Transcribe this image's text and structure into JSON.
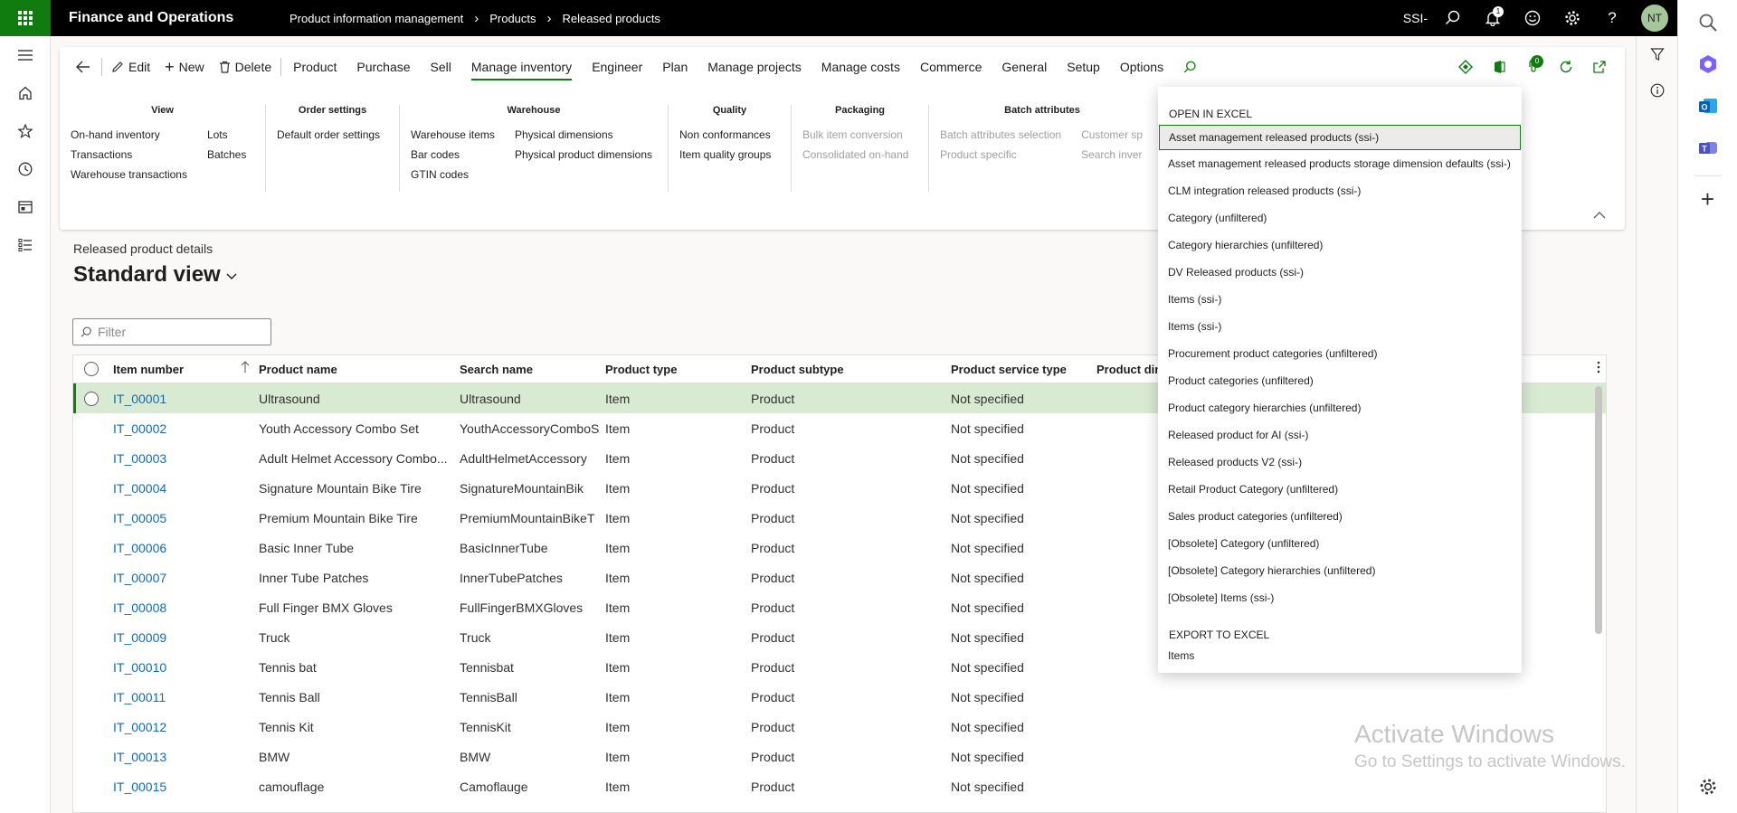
{
  "header": {
    "app_title": "Finance and Operations",
    "breadcrumbs": [
      "Product information management",
      "Products",
      "Released products"
    ],
    "company": "SSI-",
    "notification_count": "1",
    "user_initials": "NT"
  },
  "actionpane": {
    "back_icon": "back-arrow-icon",
    "buttons": [
      {
        "label": "Edit",
        "icon": "pencil-icon"
      },
      {
        "label": "New",
        "icon": "plus-icon"
      },
      {
        "label": "Delete",
        "icon": "trash-icon"
      }
    ],
    "tabs": [
      "Product",
      "Purchase",
      "Sell",
      "Manage inventory",
      "Engineer",
      "Plan",
      "Manage projects",
      "Manage costs",
      "Commerce",
      "General",
      "Setup",
      "Options"
    ],
    "active_tab": "Manage inventory",
    "office_badge": "0",
    "groups": [
      {
        "title": "View",
        "columns": [
          [
            "On-hand inventory",
            "Transactions",
            "Warehouse transactions"
          ],
          [
            "Lots",
            "Batches"
          ]
        ]
      },
      {
        "title": "Order settings",
        "columns": [
          [
            "Default order settings"
          ]
        ]
      },
      {
        "title": "Warehouse",
        "columns": [
          [
            "Warehouse items",
            "Bar codes",
            "GTIN codes"
          ],
          [
            "Physical dimensions",
            "Physical product dimensions"
          ]
        ]
      },
      {
        "title": "Quality",
        "columns": [
          [
            "Non conformances",
            "Item quality groups"
          ]
        ]
      },
      {
        "title": "Packaging",
        "columns": [
          [
            "Bulk item conversion",
            "Consolidated on-hand"
          ]
        ]
      },
      {
        "title": "Batch attributes",
        "columns": [
          [
            "Batch attributes selection",
            "Product specific"
          ],
          [
            "Customer sp",
            "Search inver"
          ]
        ]
      }
    ]
  },
  "page": {
    "subtitle": "Released product details",
    "view_name": "Standard view",
    "filter_placeholder": "Filter"
  },
  "grid": {
    "columns": [
      "Item number",
      "Product name",
      "Search name",
      "Product type",
      "Product subtype",
      "Product service type",
      "Product dime"
    ],
    "rows": [
      {
        "item": "IT_00001",
        "name": "Ultrasound",
        "search": "Ultrasound",
        "type": "Item",
        "subtype": "Product",
        "service": "Not specified"
      },
      {
        "item": "IT_00002",
        "name": "Youth Accessory Combo Set",
        "search": "YouthAccessoryComboS",
        "type": "Item",
        "subtype": "Product",
        "service": "Not specified"
      },
      {
        "item": "IT_00003",
        "name": "Adult Helmet Accessory Combo...",
        "search": "AdultHelmetAccessory",
        "type": "Item",
        "subtype": "Product",
        "service": "Not specified"
      },
      {
        "item": "IT_00004",
        "name": "Signature Mountain Bike Tire",
        "search": "SignatureMountainBik",
        "type": "Item",
        "subtype": "Product",
        "service": "Not specified"
      },
      {
        "item": "IT_00005",
        "name": "Premium Mountain Bike Tire",
        "search": "PremiumMountainBikeT",
        "type": "Item",
        "subtype": "Product",
        "service": "Not specified"
      },
      {
        "item": "IT_00006",
        "name": "Basic Inner Tube",
        "search": "BasicInnerTube",
        "type": "Item",
        "subtype": "Product",
        "service": "Not specified"
      },
      {
        "item": "IT_00007",
        "name": "Inner Tube Patches",
        "search": "InnerTubePatches",
        "type": "Item",
        "subtype": "Product",
        "service": "Not specified"
      },
      {
        "item": "IT_00008",
        "name": "Full Finger BMX Gloves",
        "search": "FullFingerBMXGloves",
        "type": "Item",
        "subtype": "Product",
        "service": "Not specified"
      },
      {
        "item": "IT_00009",
        "name": "Truck",
        "search": "Truck",
        "type": "Item",
        "subtype": "Product",
        "service": "Not specified"
      },
      {
        "item": "IT_00010",
        "name": "Tennis bat",
        "search": "Tennisbat",
        "type": "Item",
        "subtype": "Product",
        "service": "Not specified"
      },
      {
        "item": "IT_00011",
        "name": "Tennis Ball",
        "search": "TennisBall",
        "type": "Item",
        "subtype": "Product",
        "service": "Not specified"
      },
      {
        "item": "IT_00012",
        "name": "Tennis Kit",
        "search": "TennisKit",
        "type": "Item",
        "subtype": "Product",
        "service": "Not specified"
      },
      {
        "item": "IT_00013",
        "name": "BMW",
        "search": "BMW",
        "type": "Item",
        "subtype": "Product",
        "service": "Not specified"
      },
      {
        "item": "IT_00015",
        "name": "camouflage",
        "search": "Camoflauge",
        "type": "Item",
        "subtype": "Product",
        "service": "Not specified"
      }
    ]
  },
  "excel_menu": {
    "open_header": "OPEN IN EXCEL",
    "open_items": [
      "Asset management released products (ssi-)",
      "Asset management released products storage dimension defaults (ssi-)",
      "CLM integration released products (ssi-)",
      "Category (unfiltered)",
      "Category hierarchies (unfiltered)",
      "DV Released products (ssi-)",
      "Items (ssi-)",
      "Items (ssi-)",
      "Procurement product categories (unfiltered)",
      "Product categories (unfiltered)",
      "Product category hierarchies (unfiltered)",
      "Released product for AI (ssi-)",
      "Released products V2 (ssi-)",
      "Retail Product Category (unfiltered)",
      "Sales product categories (unfiltered)",
      "[Obsolete] Category (unfiltered)",
      "[Obsolete] Category hierarchies (unfiltered)",
      "[Obsolete] Items (ssi-)"
    ],
    "export_header": "EXPORT TO EXCEL",
    "export_items": [
      "Items"
    ]
  },
  "watermark": {
    "line1": "Activate Windows",
    "line2": "Go to Settings to activate Windows."
  },
  "colors": {
    "brand_green": "#107c10",
    "link_blue": "#0f6cbd",
    "selected_row": "#d9ead3"
  }
}
